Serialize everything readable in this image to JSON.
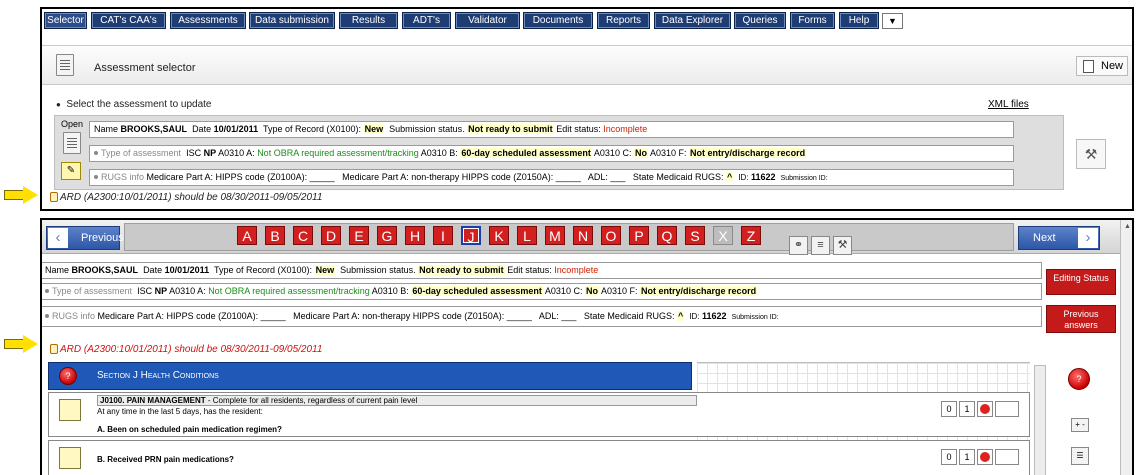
{
  "menu": {
    "items": [
      "Selector",
      "CAT's CAA's",
      "Assessments",
      "Data submission",
      "Results",
      "ADT's",
      "Validator",
      "Documents",
      "Reports",
      "Data Explorer",
      "Queries",
      "Forms",
      "Help"
    ],
    "more_icon": "chevron-down-icon"
  },
  "selector": {
    "title": "Assessment selector",
    "new_label": "New",
    "prompt": "Select the assessment to update",
    "xml_files": "XML files",
    "open_label": "Open"
  },
  "record": {
    "name_label": "Name",
    "name": "BROOKS,SAUL",
    "date_label": "Date",
    "date": "10/01/2011",
    "type_label": "Type of Record (X0100):",
    "type": "New",
    "sub_status_label": "Submission status.",
    "sub_status": "Not ready to submit",
    "edit_status_label": "Edit status:",
    "edit_status": "Incomplete",
    "assess_type_label": "Type of assessment",
    "isc_label": "ISC",
    "isc": "NP",
    "a0310a_label": "A0310 A:",
    "a0310a": "Not OBRA required assessment/tracking",
    "a0310b_label": "A0310 B:",
    "a0310b": "60-day scheduled assessment",
    "a0310c_label": "A0310 C:",
    "a0310c": "No",
    "a0310f_label": "A0310 F:",
    "a0310f": "Not entry/discharge record",
    "rugs_label": "RUGS info",
    "hipps_label": "Medicare Part A: HIPPS code (Z0100A):",
    "hipps_nt_label": "Medicare Part A: non-therapy HIPPS code (Z0150A):",
    "adl_label": "ADL:",
    "state_rugs_label": "State Medicaid RUGS:",
    "state_rugs": "^",
    "id_label": "ID:",
    "id": "11622",
    "submission_id_label": "Submission ID:",
    "blank": "_____",
    "blank_short": "___"
  },
  "warning": "ARD (A2300:10/01/2011) should be 08/30/2011-09/05/2011",
  "nav": {
    "previous": "Previous",
    "next": "Next",
    "letters": [
      "A",
      "B",
      "C",
      "D",
      "E",
      "G",
      "H",
      "I",
      "J",
      "K",
      "L",
      "M",
      "N",
      "O",
      "P",
      "Q",
      "S",
      "X",
      "Z"
    ],
    "selected_letter": "J",
    "disabled_letters": [
      "X"
    ]
  },
  "side": {
    "editing_status": "Editing Status",
    "previous_answers": "Previous answers"
  },
  "section": {
    "title": "Section J Health Conditions"
  },
  "questions": {
    "j0100_code": "J0100. PAIN MANAGEMENT",
    "j0100_desc": " - Complete for all residents, regardless of current pain level",
    "j0100_sub": "At any time in the last 5 days, has the resident:",
    "a_label": "A. Been on scheduled pain medication regimen?",
    "b_label": "B. Received PRN pain medications?",
    "opt0": "0",
    "opt1": "1",
    "plus_minus": "+ -"
  },
  "colors": {
    "menu_blue": "#1f3d75",
    "letter_red": "#d21f1f",
    "section_blue": "#1f58b7",
    "highlight": "#ffffc8",
    "arrow_yellow": "#ffe000"
  }
}
